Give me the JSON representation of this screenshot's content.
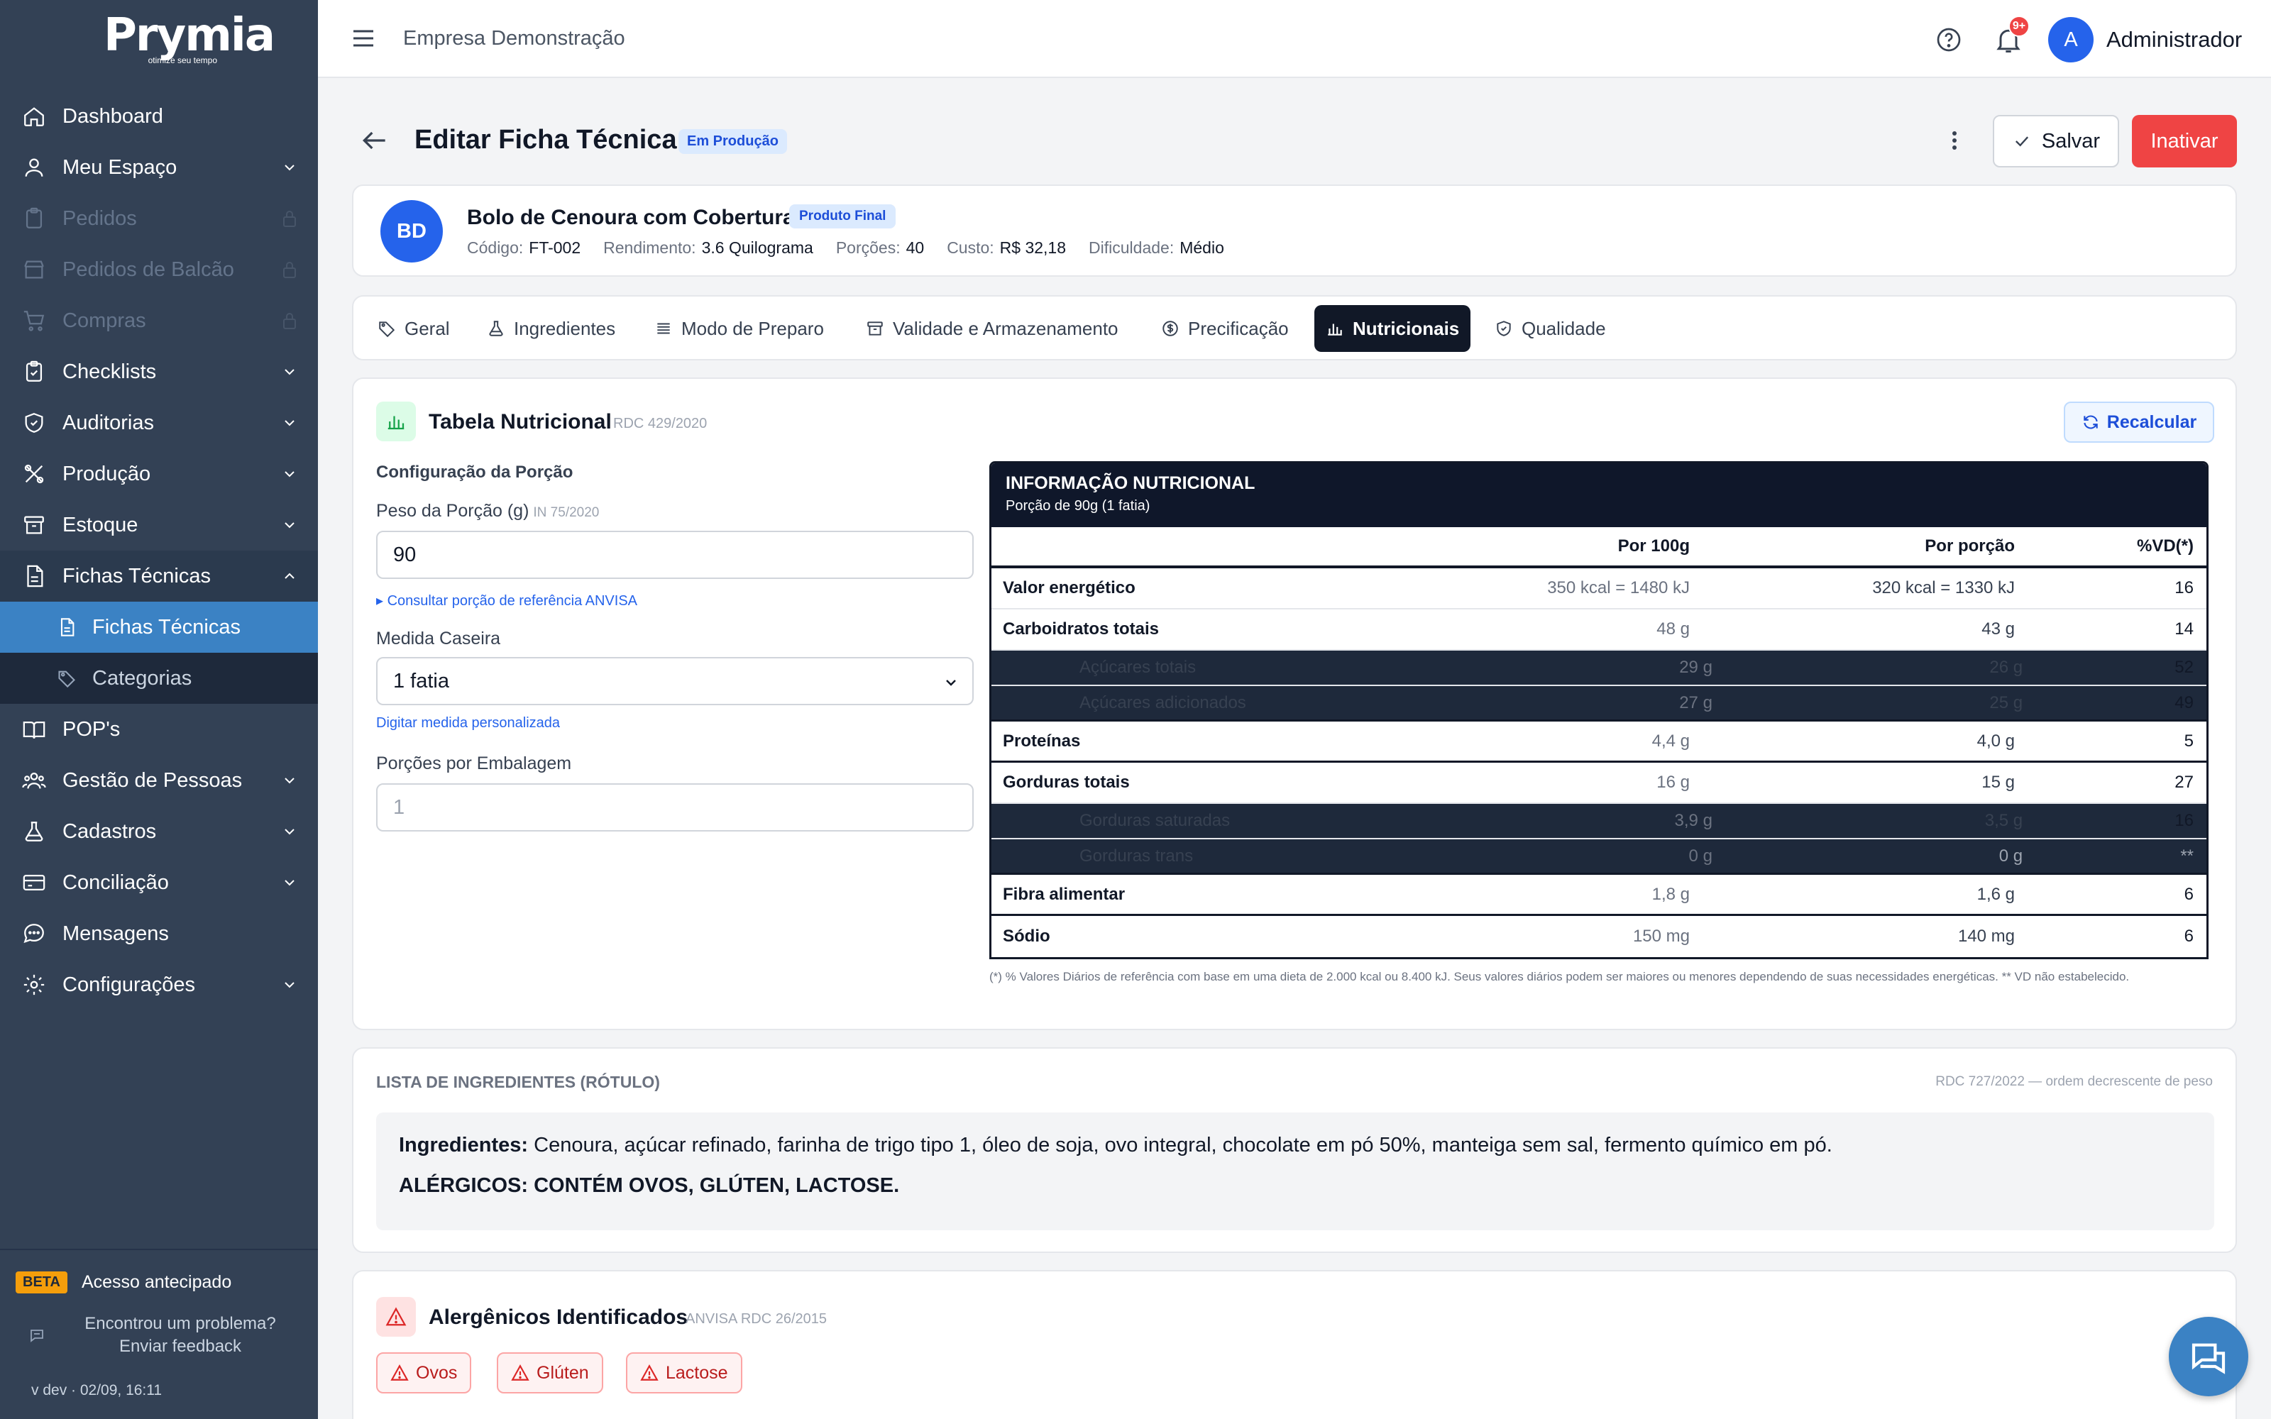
{
  "sidebar": {
    "logo": "Prymia",
    "tagline": "otimize seu tempo",
    "items": [
      {
        "label": "Dashboard"
      },
      {
        "label": "Meu Espaço"
      },
      {
        "label": "Pedidos"
      },
      {
        "label": "Pedidos de Balcão"
      },
      {
        "label": "Compras"
      },
      {
        "label": "Checklists"
      },
      {
        "label": "Auditorias"
      },
      {
        "label": "Produção"
      },
      {
        "label": "Estoque"
      },
      {
        "label": "Fichas Técnicas"
      },
      {
        "label": "POP's"
      },
      {
        "label": "Gestão de Pessoas"
      },
      {
        "label": "Cadastros"
      },
      {
        "label": "Conciliação"
      },
      {
        "label": "Mensagens"
      },
      {
        "label": "Configurações"
      }
    ],
    "subitems": [
      {
        "label": "Fichas Técnicas"
      },
      {
        "label": "Categorias"
      }
    ],
    "beta_badge": "BETA",
    "beta_text": "Acesso antecipado",
    "feedback_line1": "Encontrou um problema?",
    "feedback_line2": "Enviar feedback",
    "version": "v dev · 02/09, 16:11"
  },
  "topbar": {
    "company": "Empresa Demonstração",
    "notif_count": "9+",
    "avatar_initial": "A",
    "user_name": "Administrador"
  },
  "page": {
    "title": "Editar Ficha Técnica",
    "status": "Em Produção",
    "save_label": "Salvar",
    "inactivate_label": "Inativar"
  },
  "product": {
    "initials": "BD",
    "name": "Bolo de Cenoura com Cobertura",
    "type": "Produto Final",
    "code_label": "Código:",
    "code": "FT-002",
    "yield_label": "Rendimento:",
    "yield": "3.6 Quilograma",
    "portions_label": "Porções:",
    "portions": "40",
    "cost_label": "Custo:",
    "cost": "R$ 32,18",
    "difficulty_label": "Dificuldade:",
    "difficulty": "Médio"
  },
  "tabs": [
    {
      "label": "Geral"
    },
    {
      "label": "Ingredientes"
    },
    {
      "label": "Modo de Preparo"
    },
    {
      "label": "Validade e Armazenamento"
    },
    {
      "label": "Precificação"
    },
    {
      "label": "Nutricionais"
    },
    {
      "label": "Qualidade"
    }
  ],
  "active_tab": "Nutricionais",
  "nutrition": {
    "title": "Tabela Nutricional",
    "ref": "RDC 429/2020",
    "recalc_label": "Recalcular",
    "config_title": "Configuração da Porção",
    "portion_weight_label": "Peso da Porção (g)",
    "portion_weight_ref": "IN 75/2020",
    "portion_weight_value": "90",
    "anvisa_link": "▸ Consultar porção de referência ANVISA",
    "household_label": "Medida Caseira",
    "household_value": "1 fatia",
    "custom_measure_link": "Digitar medida personalizada",
    "per_package_label": "Porções por Embalagem",
    "per_package_placeholder": "1",
    "table_title": "INFORMAÇÃO NUTRICIONAL",
    "table_subtitle": "Porção de 90g (1 fatia)",
    "col_100g": "Por 100g",
    "col_portion": "Por porção",
    "col_vd": "%VD(*)",
    "rows": [
      {
        "name": "Valor energético",
        "per100": "350 kcal = 1480 kJ",
        "portion": "320 kcal = 1330 kJ",
        "vd": "16"
      },
      {
        "name": "Carboidratos totais",
        "per100": "48 g",
        "portion": "43 g",
        "vd": "14"
      },
      {
        "name": "Açúcares totais",
        "per100": "29 g",
        "portion": "26 g",
        "vd": "52"
      },
      {
        "name": "Açúcares adicionados",
        "per100": "27 g",
        "portion": "25 g",
        "vd": "49"
      },
      {
        "name": "Proteínas",
        "per100": "4,4 g",
        "portion": "4,0 g",
        "vd": "5"
      },
      {
        "name": "Gorduras totais",
        "per100": "16 g",
        "portion": "15 g",
        "vd": "27"
      },
      {
        "name": "Gorduras saturadas",
        "per100": "3,9 g",
        "portion": "3,5 g",
        "vd": "16"
      },
      {
        "name": "Gorduras trans",
        "per100": "0 g",
        "portion": "0 g",
        "vd": "**"
      },
      {
        "name": "Fibra alimentar",
        "per100": "1,8 g",
        "portion": "1,6 g",
        "vd": "6"
      },
      {
        "name": "Sódio",
        "per100": "150 mg",
        "portion": "140 mg",
        "vd": "6"
      }
    ],
    "footnote": "(*) % Valores Diários de referência com base em uma dieta de 2.000 kcal ou 8.400 kJ. Seus valores diários podem ser maiores ou menores dependendo de suas necessidades energéticas. ** VD não estabelecido."
  },
  "ingredients": {
    "title": "LISTA DE INGREDIENTES (RÓTULO)",
    "ref": "RDC 727/2022 — ordem decrescente de peso",
    "label": "Ingredientes:",
    "text": " Cenoura, açúcar refinado, farinha de trigo tipo 1, óleo de soja, ovo integral, chocolate em pó 50%, manteiga sem sal, fermento químico em pó.",
    "allergens_text": "ALÉRGICOS: CONTÉM OVOS, GLÚTEN, LACTOSE."
  },
  "allergens": {
    "title": "Alergênicos Identificados",
    "ref": "ANVISA RDC 26/2015",
    "chips": [
      {
        "label": "Ovos"
      },
      {
        "label": "Glúten"
      },
      {
        "label": "Lactose"
      }
    ]
  }
}
